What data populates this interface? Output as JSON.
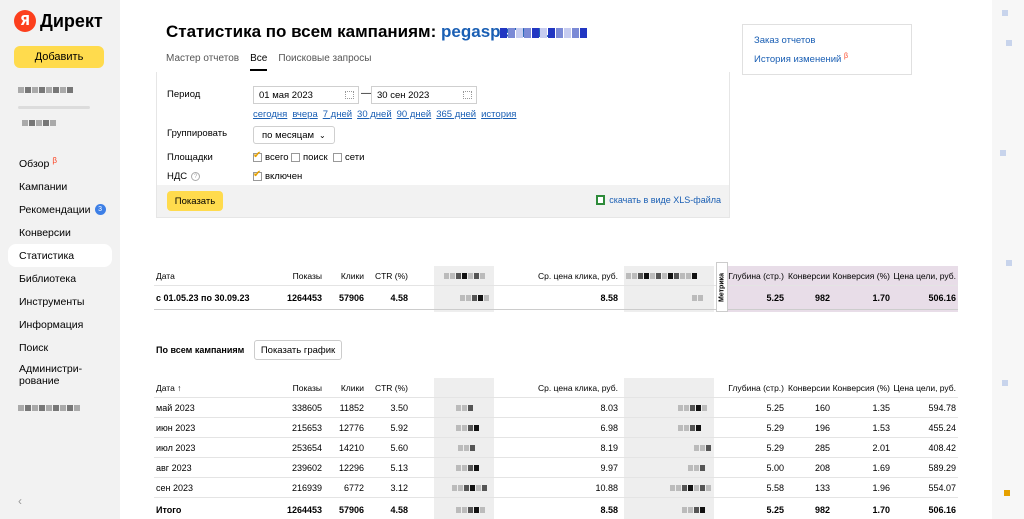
{
  "sidebar": {
    "brand": "Директ",
    "brand_letter": "Я",
    "add_label": "Добавить",
    "nav": [
      {
        "label": "Обзор",
        "beta": "β"
      },
      {
        "label": "Кампании"
      },
      {
        "label": "Рекомендации",
        "badge": "3"
      },
      {
        "label": "Конверсии"
      },
      {
        "label": "Статистика"
      },
      {
        "label": "Библиотека"
      },
      {
        "label": "Инструменты"
      },
      {
        "label": "Информация"
      },
      {
        "label": "Поиск"
      },
      {
        "label": "Админи­стри-\nрование"
      }
    ],
    "collapse": "‹"
  },
  "header": {
    "title": "Статистика по всем кампаниям:",
    "site": "pegasperm.ru"
  },
  "tabs": [
    "Мастер отчетов",
    "Все",
    "Поисковые запросы"
  ],
  "side_links": {
    "orders": "Заказ отчетов",
    "history": "История изменений",
    "history_beta": "β"
  },
  "filters": {
    "period_label": "Период",
    "date_from": "01 мая 2023",
    "date_to": "30 сен 2023",
    "dash": "—",
    "quick": [
      "сегодня",
      "вчера",
      "7 дней",
      "30 дней",
      "90 дней",
      "365 дней",
      "история"
    ],
    "group_label": "Группировать",
    "group_value": "по месяцам",
    "places_label": "Площадки",
    "places": [
      "всего",
      "поиск",
      "сети"
    ],
    "vat_label": "НДС",
    "vat_value": "включен",
    "show_label": "Показать",
    "xls_label": "скачать в виде XLS-файла"
  },
  "summary": {
    "headers": {
      "date": "Дата",
      "shows": "Показы",
      "clicks": "Клики",
      "ctr": "CTR (%)",
      "cpc": "Ср. цена клика, руб.",
      "depth": "Глубина (стр.)",
      "conv": "Конверсии",
      "convrate": "Конверсия (%)",
      "goal": "Цена цели, руб."
    },
    "metrika": "Метрика",
    "row": {
      "date": "с 01.05.23 по 30.09.23",
      "shows": "1264453",
      "clicks": "57906",
      "ctr": "4.58",
      "cpc": "8.58",
      "depth": "5.25",
      "conv": "982",
      "convrate": "1.70",
      "goal": "506.16"
    }
  },
  "monthly": {
    "title": "По всем кампаниям",
    "graph_btn": "Показать график",
    "headers": {
      "date": "Дата ↑",
      "shows": "Показы",
      "clicks": "Клики",
      "ctr": "CTR (%)",
      "cpc": "Ср. цена клика, руб.",
      "depth": "Глубина (стр.)",
      "conv": "Конверсии",
      "convrate": "Конверсия (%)",
      "goal": "Цена цели, руб."
    },
    "rows": [
      {
        "date": "май 2023",
        "shows": "338605",
        "clicks": "11852",
        "ctr": "3.50",
        "cpc": "8.03",
        "depth": "5.25",
        "conv": "160",
        "convrate": "1.35",
        "goal": "594.78"
      },
      {
        "date": "июн 2023",
        "shows": "215653",
        "clicks": "12776",
        "ctr": "5.92",
        "cpc": "6.98",
        "depth": "5.29",
        "conv": "196",
        "convrate": "1.53",
        "goal": "455.24"
      },
      {
        "date": "июл 2023",
        "shows": "253654",
        "clicks": "14210",
        "ctr": "5.60",
        "cpc": "8.19",
        "depth": "5.29",
        "conv": "285",
        "convrate": "2.01",
        "goal": "408.42"
      },
      {
        "date": "авг 2023",
        "shows": "239602",
        "clicks": "12296",
        "ctr": "5.13",
        "cpc": "9.97",
        "depth": "5.00",
        "conv": "208",
        "convrate": "1.69",
        "goal": "589.29"
      },
      {
        "date": "сен 2023",
        "shows": "216939",
        "clicks": "6772",
        "ctr": "3.12",
        "cpc": "10.88",
        "depth": "5.58",
        "conv": "133",
        "convrate": "1.96",
        "goal": "554.07"
      }
    ],
    "total": {
      "date": "Итого",
      "shows": "1264453",
      "clicks": "57906",
      "ctr": "4.58",
      "cpc": "8.58",
      "depth": "5.25",
      "conv": "982",
      "convrate": "1.70",
      "goal": "506.16"
    }
  }
}
